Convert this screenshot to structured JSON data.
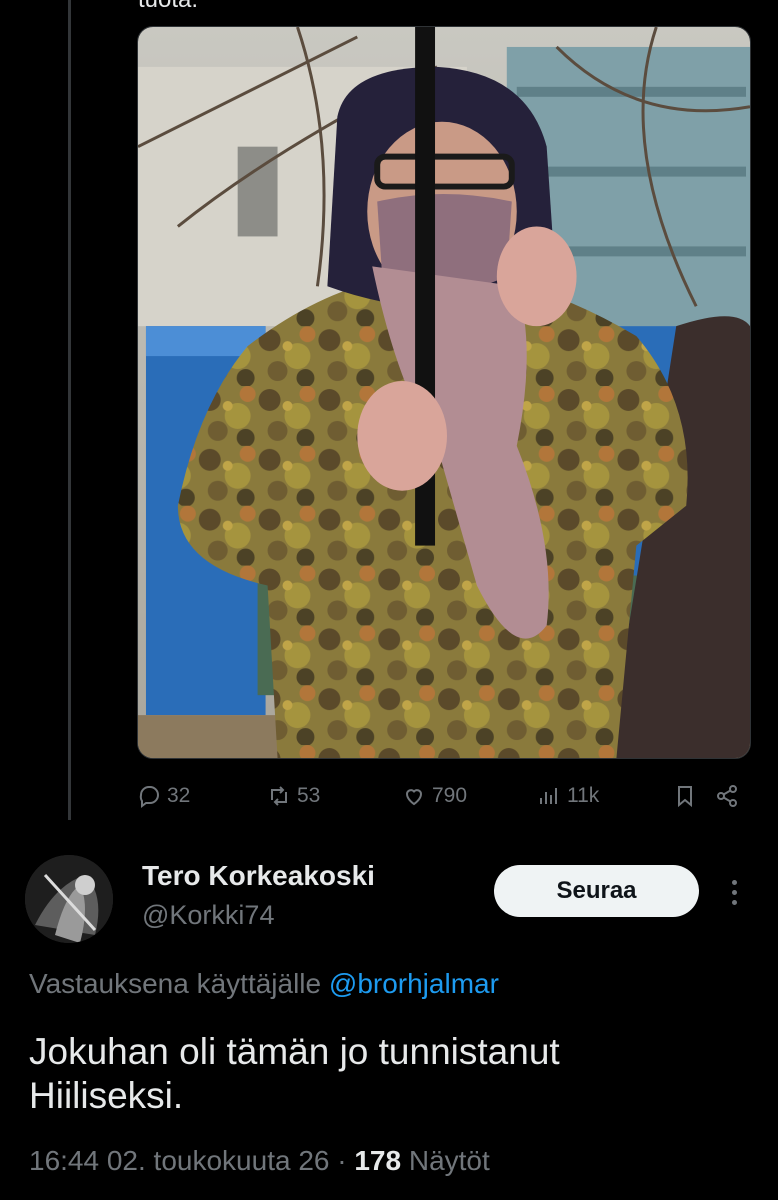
{
  "quoted_tweet": {
    "clipped_text": "tuota.",
    "media_icon": "photo",
    "stats": {
      "replies": "32",
      "reposts": "53",
      "likes": "790",
      "views": "11k"
    },
    "icons": {
      "reply": "reply-icon",
      "repost": "repost-icon",
      "like": "like-icon",
      "views": "views-icon",
      "bookmark": "bookmark-icon",
      "share": "share-icon"
    }
  },
  "tweet": {
    "author": {
      "display_name": "Tero Korkeakoski",
      "handle": "@Korkki74"
    },
    "follow_label": "Seuraa",
    "reply_prefix": "Vastauksena käyttäjälle",
    "reply_handle": "@brorhjalmar",
    "text_line1": "Jokuhan oli tämän jo tunnistanut",
    "text_line2": "Hiiliseksi.",
    "timestamp": "16:44 02. toukokuuta 26",
    "separator": "·",
    "views_count": "178",
    "views_label": "Näytöt"
  },
  "colors": {
    "background": "#000000",
    "text_primary": "#e7e9ea",
    "text_secondary": "#71767b",
    "link": "#1d9bf0",
    "button_bg": "#eff3f4"
  }
}
